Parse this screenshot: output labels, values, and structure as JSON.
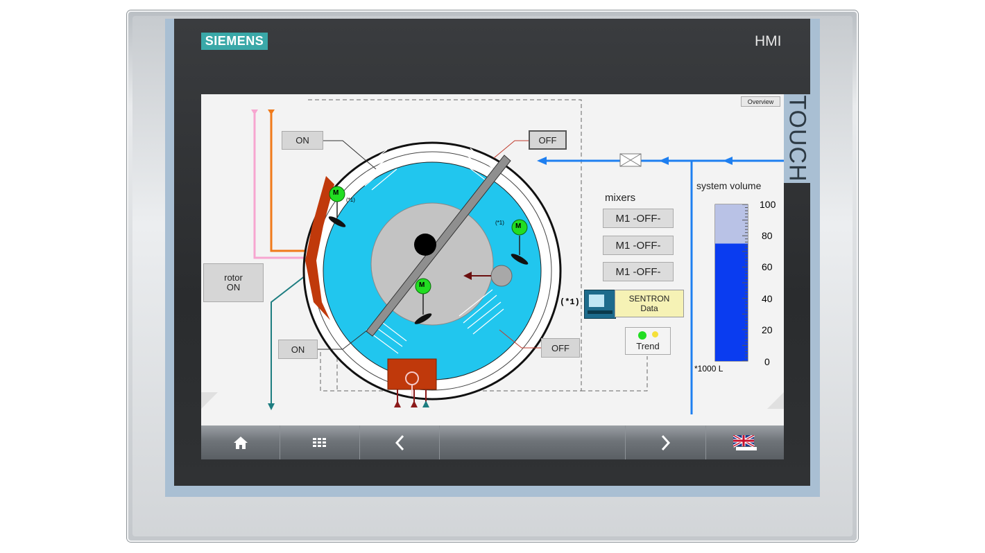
{
  "device": {
    "brand": "SIEMENS",
    "model_label": "HMI",
    "touch_label": "TOUCH"
  },
  "screen": {
    "overview_button": "Overview",
    "buttons": {
      "on_top": "ON",
      "off_top": "OFF",
      "on_bottom": "ON",
      "off_bottom": "OFF",
      "rotor_line1": "rotor",
      "rotor_line2": "ON"
    },
    "motor_label": "M",
    "note_marker": "(*1)",
    "note_marker_large": "(*1)",
    "mixers": {
      "title": "mixers",
      "items": [
        "M1 -OFF-",
        "M1 -OFF-",
        "M1 -OFF-"
      ]
    },
    "sentron": {
      "line1": "SENTRON",
      "line2": "Data"
    },
    "trend_label": "Trend",
    "volume": {
      "title": "system volume",
      "scale": [
        "100",
        "80",
        "60",
        "40",
        "20",
        "0"
      ],
      "unit": "*1000 L",
      "level_percent": 75
    },
    "colors": {
      "tank_blue": "#21c6ee",
      "motor_green": "#22dd22",
      "rotor_red": "#c0390b",
      "level_blue": "#0a3cf0",
      "pipe_blue": "#1e7ff0"
    }
  },
  "nav": {
    "items": [
      {
        "icon": "home-icon"
      },
      {
        "icon": "menu-grid-icon"
      },
      {
        "icon": "back-arrow-icon"
      },
      {
        "icon": "blank"
      },
      {
        "icon": "forward-arrow-icon"
      },
      {
        "icon": "language-flag-icon"
      }
    ]
  }
}
